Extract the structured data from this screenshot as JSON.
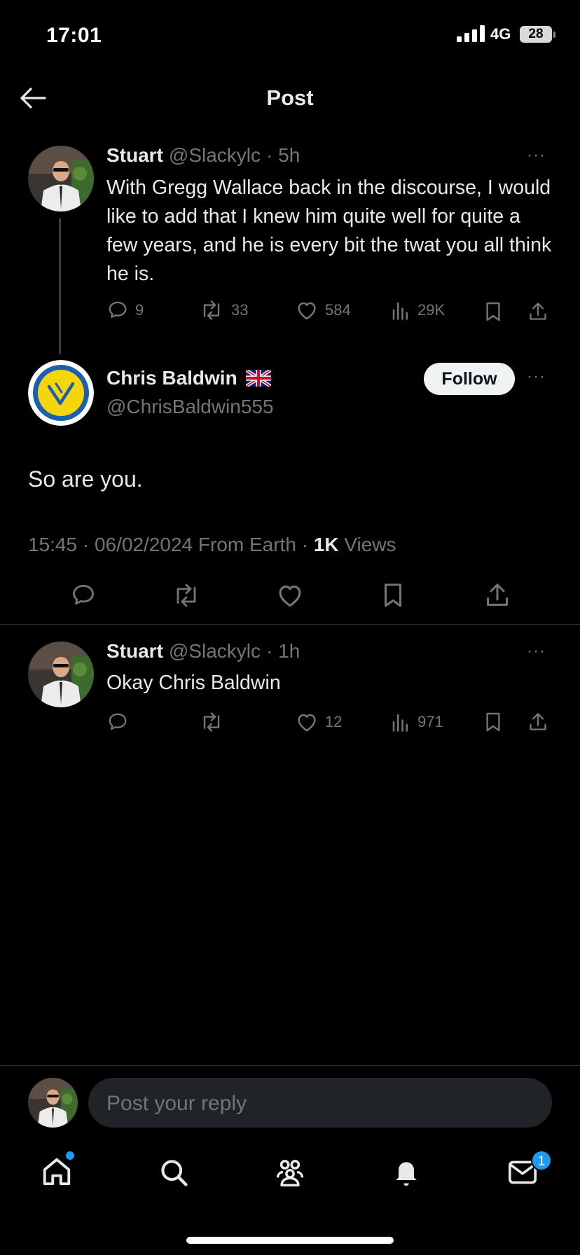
{
  "status_bar": {
    "time": "17:01",
    "network": "4G",
    "battery": "28"
  },
  "header": {
    "title": "Post"
  },
  "parent_post": {
    "name": "Stuart",
    "handle": "@Slackylc",
    "time": "· 5h",
    "text": "With Gregg Wallace back in the discourse, I would like to add that I knew him quite well for quite a few years, and he is every bit the twat you all think he is.",
    "replies": "9",
    "reposts": "33",
    "likes": "584",
    "views": "29K"
  },
  "main_post": {
    "name": "Chris Baldwin",
    "flag": "🇬🇧",
    "handle": "@ChrisBaldwin555",
    "follow_label": "Follow",
    "text": "So are you.",
    "timestamp": "15:45 · 06/02/2024 From Earth · ",
    "views_count": "1K",
    "views_label": " Views"
  },
  "reply_post": {
    "name": "Stuart",
    "handle": "@Slackylc",
    "time": "· 1h",
    "text": "Okay Chris Baldwin",
    "likes": "12",
    "views": "971"
  },
  "composer": {
    "placeholder": "Post your reply"
  },
  "tab_bar": {
    "items": [
      "home-icon",
      "search-icon",
      "communities-icon",
      "notifications-icon",
      "messages-icon"
    ],
    "messages_badge": "1"
  },
  "colors": {
    "accent": "#1d9bf0",
    "muted": "#71767b",
    "text": "#e7e9ea",
    "leeds_yellow": "#f5d60c",
    "leeds_blue": "#1b5fb0"
  }
}
